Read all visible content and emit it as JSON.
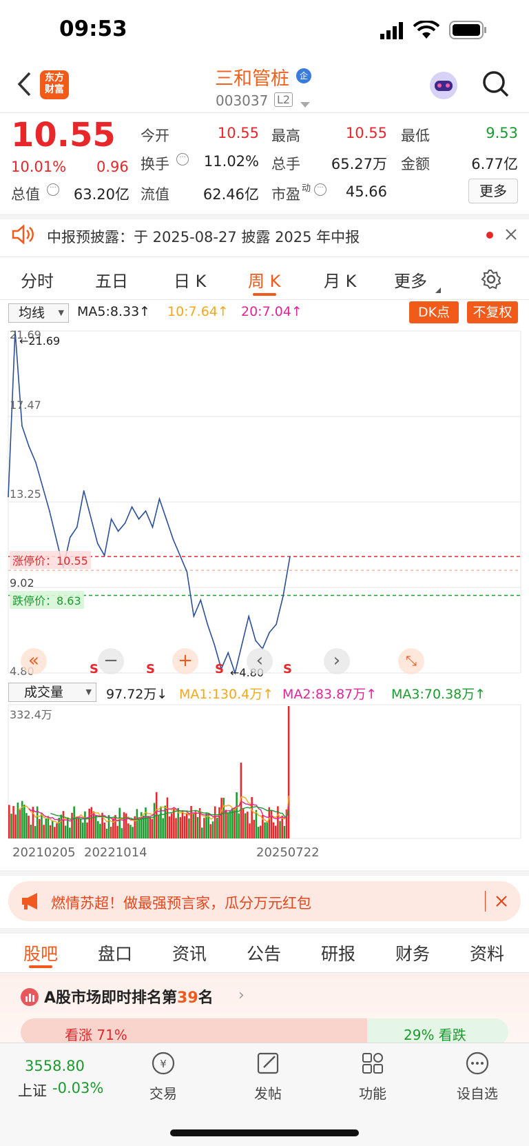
{
  "status_bar": {
    "time": "09:53"
  },
  "header": {
    "logo_text_1": "东方",
    "logo_text_2": "财富",
    "stock_name": "三和管桩",
    "badge": "企",
    "stock_code": "003037",
    "level": "L2"
  },
  "quote": {
    "price": "10.55",
    "change_pct": "10.01%",
    "change": "0.96",
    "labels": {
      "open": "今开",
      "high": "最高",
      "low": "最低",
      "turnover": "换手",
      "volume": "总手",
      "amount": "金额",
      "mktcap": "总值",
      "float_cap": "流值",
      "pe": "市盈",
      "pe_sup": "动",
      "more": "更多"
    },
    "open": "10.55",
    "high": "10.55",
    "low": "9.53",
    "turnover": "11.02%",
    "volume": "65.27万",
    "amount": "6.77亿",
    "mktcap": "63.20亿",
    "float_cap": "62.46亿",
    "pe": "45.66"
  },
  "notice": {
    "text": "中报预披露：于 2025-08-27 披露 2025 年中报"
  },
  "chart_tabs": [
    "分时",
    "五日",
    "日 K",
    "周 K",
    "月 K",
    "更多"
  ],
  "active_tab": "周 K",
  "ma_row": {
    "selector": "均线",
    "ma5": "MA5:8.33↑",
    "ma10": "10:7.64↑",
    "ma20": "20:7.04↑",
    "dk_btn": "DK点",
    "adj_btn": "不复权"
  },
  "price_chart": {
    "y_labels": [
      "21.69",
      "17.47",
      "13.25",
      "9.02",
      "4.80"
    ],
    "max_label": "←21.69",
    "min_label": "←4.80",
    "limit_up_label": "涨停价：10.55",
    "limit_down_label": "跌停价：8.63",
    "s_mark": "S"
  },
  "vol_row": {
    "selector": "成交量",
    "vol": "97.72万↓",
    "ma1": "MA1:130.4万↑",
    "ma2": "MA2:83.87万↑",
    "ma3": "MA3:70.38万↑",
    "max_label": "332.4万"
  },
  "x_axis": [
    "20210205",
    "20221014",
    "20250722"
  ],
  "chart_data": {
    "type": "line",
    "title": "",
    "xlabel": "",
    "ylabel": "",
    "ylim": [
      4.8,
      21.69
    ],
    "x": [
      "20210205",
      "20221014",
      "20250722"
    ],
    "series": [
      {
        "name": "",
        "values": [
          13.5,
          21.69,
          17.0,
          16.0,
          15.2,
          14.0,
          12.8,
          11.4,
          10.0,
          11.5,
          12.0,
          13.8,
          12.5,
          11.2,
          10.6,
          12.4,
          11.8,
          12.2,
          13.0,
          12.4,
          12.8,
          12.0,
          13.4,
          12.4,
          11.4,
          10.6,
          9.8,
          7.6,
          8.4,
          7.2,
          6.2,
          5.0,
          5.8,
          4.8,
          6.2,
          7.6,
          6.4,
          6.0,
          6.8,
          7.2,
          8.6,
          10.55
        ]
      }
    ],
    "limit_up": 10.55,
    "limit_down": 8.63,
    "volume_max": 332.4
  },
  "banner": {
    "text": "燃情苏超！做最强预言家，瓜分万元红包"
  },
  "bottom_tabs": [
    "股吧",
    "盘口",
    "资讯",
    "公告",
    "研报",
    "财务",
    "资料"
  ],
  "rank": {
    "prefix": "A股市场即时排名第",
    "rank": "39",
    "suffix": "名"
  },
  "vote": {
    "up": "看涨 71%",
    "down": "29% 看跌"
  },
  "bottom_nav": {
    "index_value": "3558.80",
    "index_name": "上证",
    "index_change": "-0.03%",
    "items": [
      "交易",
      "发帖",
      "功能",
      "设自选"
    ]
  },
  "colors": {
    "up": "#e8272b",
    "down": "#1a9b2e",
    "accent": "#f25a1a",
    "line": "#2b4f95"
  }
}
